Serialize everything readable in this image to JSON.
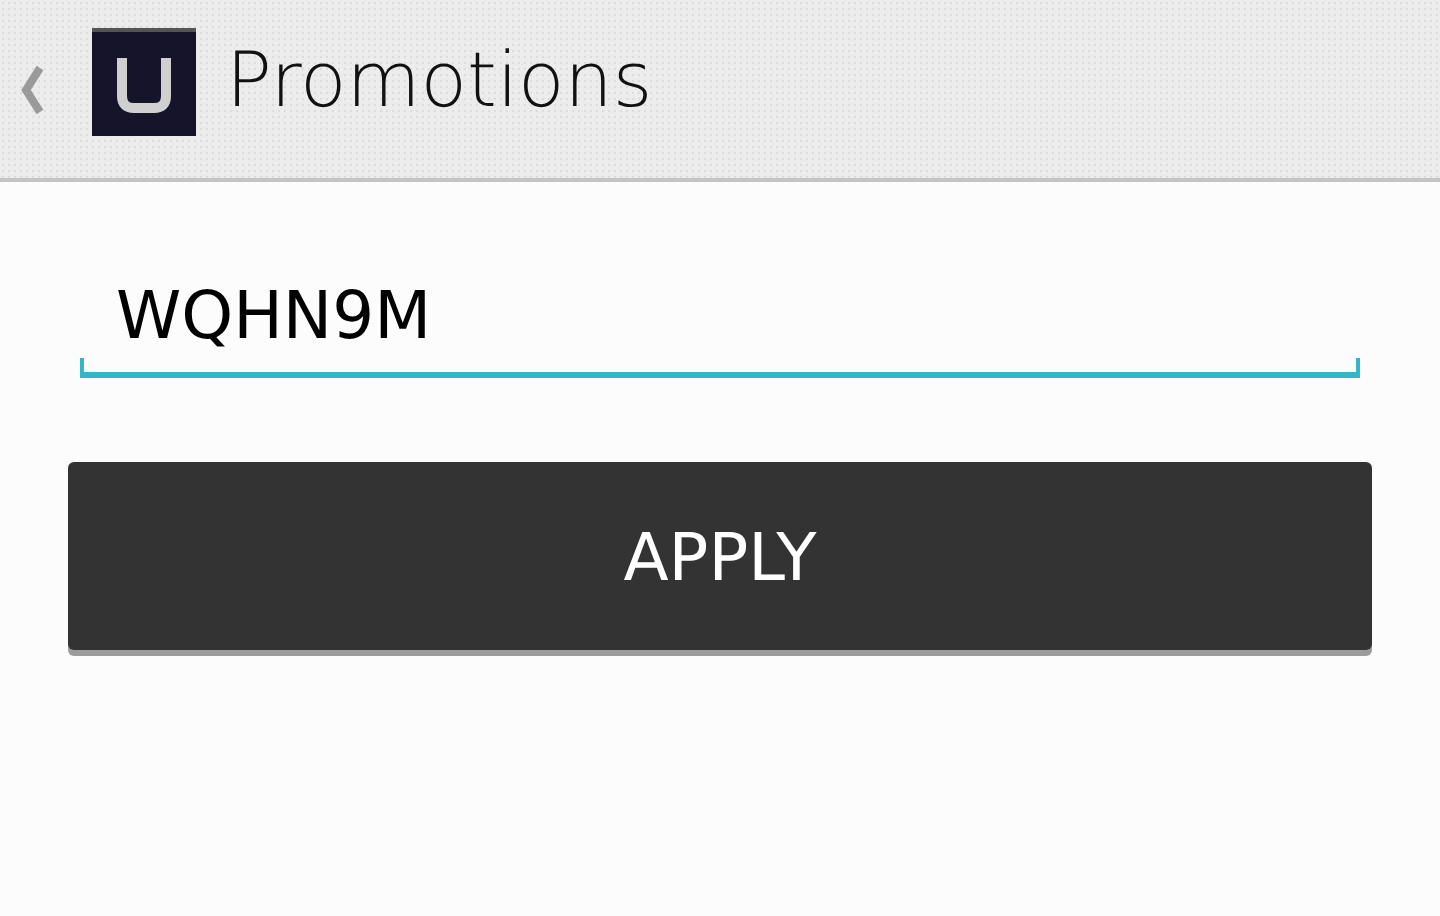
{
  "action_bar": {
    "title": "Promotions"
  },
  "promo_field": {
    "value": "WQHN9M"
  },
  "apply_button": {
    "label": "APPLY"
  }
}
